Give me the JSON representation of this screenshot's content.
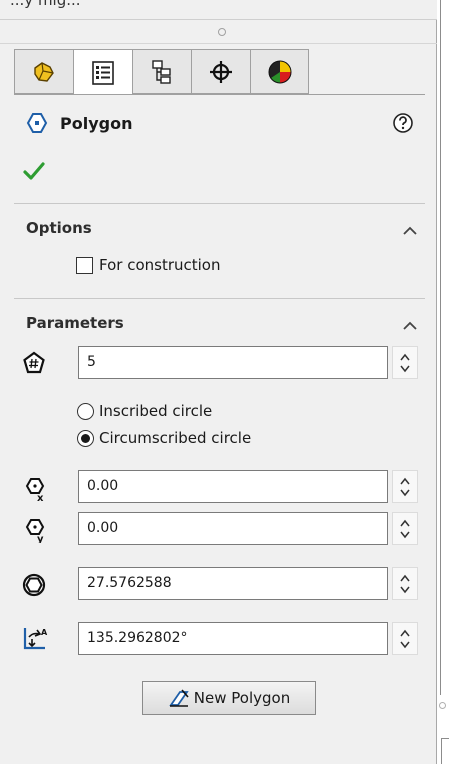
{
  "top_fragment": "...y mig...",
  "tabs": [
    {
      "icon": "feature-manager-icon",
      "active": false
    },
    {
      "icon": "property-manager-icon",
      "active": true
    },
    {
      "icon": "configuration-manager-icon",
      "active": false
    },
    {
      "icon": "dimxpert-manager-icon",
      "active": false
    },
    {
      "icon": "display-manager-icon",
      "active": false
    }
  ],
  "header": {
    "title": "Polygon",
    "title_icon": "polygon-icon",
    "help_icon": "help-icon",
    "ok_icon": "checkmark-icon"
  },
  "options": {
    "title": "Options",
    "for_construction_label": "For construction",
    "for_construction_checked": false
  },
  "parameters": {
    "title": "Parameters",
    "sides": "5",
    "inscribed_label": "Inscribed circle",
    "circumscribed_label": "Circumscribed circle",
    "selected_circle": "circumscribed",
    "center_x": "0.00",
    "center_y": "0.00",
    "diameter": "27.5762588",
    "angle": "135.2962802°"
  },
  "new_button_label": "New Polygon",
  "colors": {
    "accent_blue": "#1f5fa8",
    "check_green": "#2e9d32",
    "panel_bg": "#f0f0f0"
  }
}
